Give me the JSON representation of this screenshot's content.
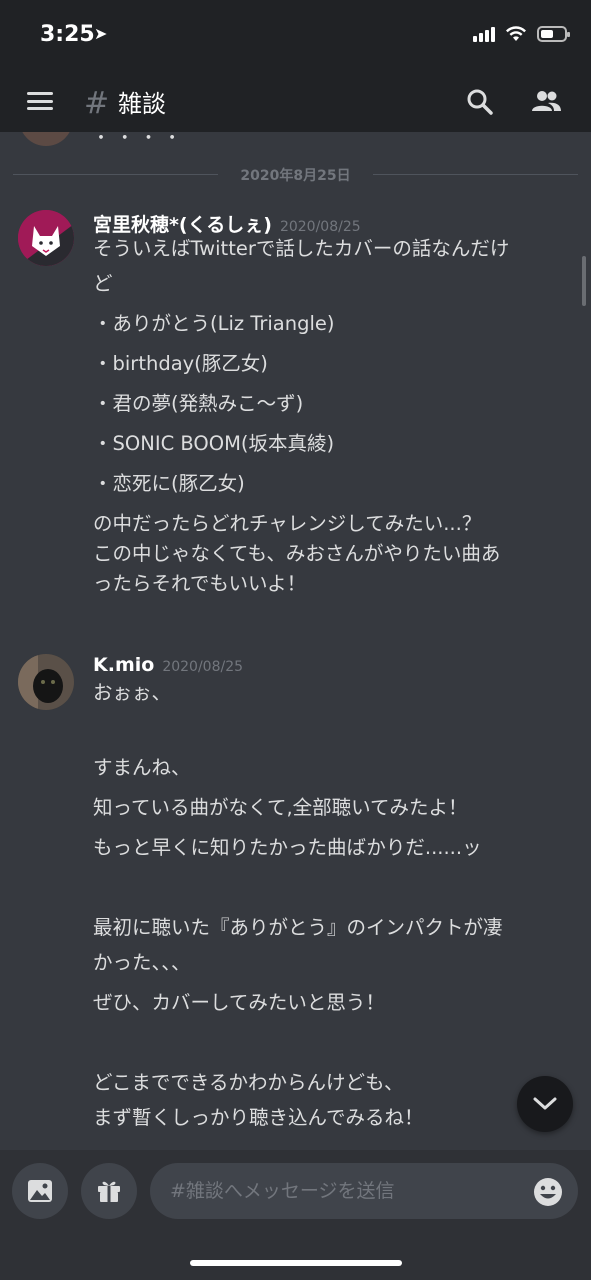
{
  "status": {
    "time": "3:25"
  },
  "header": {
    "channel": "雑談"
  },
  "chat": {
    "prev_tail": "・ ・ ・ ・",
    "date_divider": "2020年8月25日",
    "messages": [
      {
        "author": "宮里秋穂*(くるしぇ)",
        "timestamp": "2020/08/25",
        "lines": [
          "そういえばTwitterで話したカバーの話なんだけ",
          "ど",
          "・ありがとう(Liz Triangle)",
          "・birthday(豚乙女)",
          "・君の夢(発熱みこ〜ず)",
          "・SONIC BOOM(坂本真綾)",
          "・恋死に(豚乙女)",
          "の中だったらどれチャレンジしてみたい...？",
          "この中じゃなくても、みおさんがやりたい曲あ",
          "ったらそれでもいいよ！"
        ]
      },
      {
        "author": "K.mio",
        "timestamp": "2020/08/25",
        "lines": [
          "おぉぉ、",
          "",
          "すまんね、",
          "知っている曲がなくて,全部聴いてみたよ！",
          "もっと早くに知りたかった曲ばかりだ......ッ",
          "",
          "最初に聴いた『ありがとう』のインパクトが凄",
          "かった、、、",
          "ぜひ、カバーしてみたいと思う！",
          "",
          "どこまでできるかわからんけども、",
          "まず暫くしっかり聴き込んでみるね！"
        ]
      }
    ]
  },
  "composer": {
    "placeholder": "#雑談へメッセージを送信"
  },
  "colors": {
    "background": "#36393f",
    "bars": "#202225",
    "composer": "#2f3136",
    "input": "#40444b"
  },
  "icons": [
    "navigation-arrow-icon",
    "cellular-signal-icon",
    "wifi-icon",
    "battery-icon",
    "menu-icon",
    "hash-icon",
    "search-icon",
    "members-icon",
    "image-icon",
    "gift-icon",
    "emoji-icon",
    "chevron-down-icon"
  ]
}
